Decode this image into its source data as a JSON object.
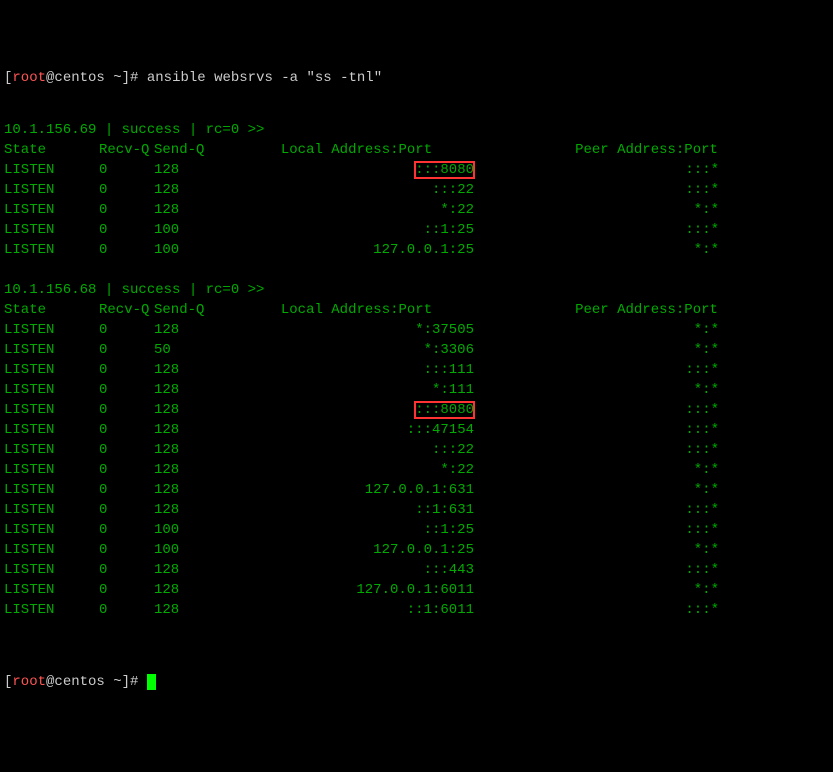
{
  "prompt": {
    "open": "[",
    "user": "root",
    "at": "@",
    "host": "centos ",
    "path": "~",
    "close": "]# ",
    "command": "ansible websrvs -a \"ss -tnl\""
  },
  "blocks": [
    {
      "status_line": "10.1.156.69 | success | rc=0 >>",
      "header": {
        "state": "State",
        "recvq": "Recv-Q",
        "sendq": "Send-Q",
        "local": "Local Address:Port",
        "peer": "Peer Address:Port"
      },
      "rows": [
        {
          "state": "LISTEN",
          "recvq": "0",
          "sendq": "128",
          "local": ":::8080",
          "peer": ":::*",
          "highlight_local": true
        },
        {
          "state": "LISTEN",
          "recvq": "0",
          "sendq": "128",
          "local": ":::22",
          "peer": ":::*"
        },
        {
          "state": "LISTEN",
          "recvq": "0",
          "sendq": "128",
          "local": "*:22",
          "peer": "*:*"
        },
        {
          "state": "LISTEN",
          "recvq": "0",
          "sendq": "100",
          "local": "::1:25",
          "peer": ":::*"
        },
        {
          "state": "LISTEN",
          "recvq": "0",
          "sendq": "100",
          "local": "127.0.0.1:25",
          "peer": "*:*"
        }
      ]
    },
    {
      "status_line": "10.1.156.68 | success | rc=0 >>",
      "header": {
        "state": "State",
        "recvq": "Recv-Q",
        "sendq": "Send-Q",
        "local": "Local Address:Port",
        "peer": "Peer Address:Port"
      },
      "rows": [
        {
          "state": "LISTEN",
          "recvq": "0",
          "sendq": "128",
          "local": "*:37505",
          "peer": "*:*"
        },
        {
          "state": "LISTEN",
          "recvq": "0",
          "sendq": "50",
          "local": "*:3306",
          "peer": "*:*"
        },
        {
          "state": "LISTEN",
          "recvq": "0",
          "sendq": "128",
          "local": ":::111",
          "peer": ":::*"
        },
        {
          "state": "LISTEN",
          "recvq": "0",
          "sendq": "128",
          "local": "*:111",
          "peer": "*:*"
        },
        {
          "state": "LISTEN",
          "recvq": "0",
          "sendq": "128",
          "local": ":::8080",
          "peer": ":::*",
          "highlight_local": true
        },
        {
          "state": "LISTEN",
          "recvq": "0",
          "sendq": "128",
          "local": ":::47154",
          "peer": ":::*"
        },
        {
          "state": "LISTEN",
          "recvq": "0",
          "sendq": "128",
          "local": ":::22",
          "peer": ":::*"
        },
        {
          "state": "LISTEN",
          "recvq": "0",
          "sendq": "128",
          "local": "*:22",
          "peer": "*:*"
        },
        {
          "state": "LISTEN",
          "recvq": "0",
          "sendq": "128",
          "local": "127.0.0.1:631",
          "peer": "*:*"
        },
        {
          "state": "LISTEN",
          "recvq": "0",
          "sendq": "128",
          "local": "::1:631",
          "peer": ":::*"
        },
        {
          "state": "LISTEN",
          "recvq": "0",
          "sendq": "100",
          "local": "::1:25",
          "peer": ":::*"
        },
        {
          "state": "LISTEN",
          "recvq": "0",
          "sendq": "100",
          "local": "127.0.0.1:25",
          "peer": "*:*"
        },
        {
          "state": "LISTEN",
          "recvq": "0",
          "sendq": "128",
          "local": ":::443",
          "peer": ":::*"
        },
        {
          "state": "LISTEN",
          "recvq": "0",
          "sendq": "128",
          "local": "127.0.0.1:6011",
          "peer": "*:*"
        },
        {
          "state": "LISTEN",
          "recvq": "0",
          "sendq": "128",
          "local": "::1:6011",
          "peer": ":::*"
        }
      ]
    }
  ]
}
